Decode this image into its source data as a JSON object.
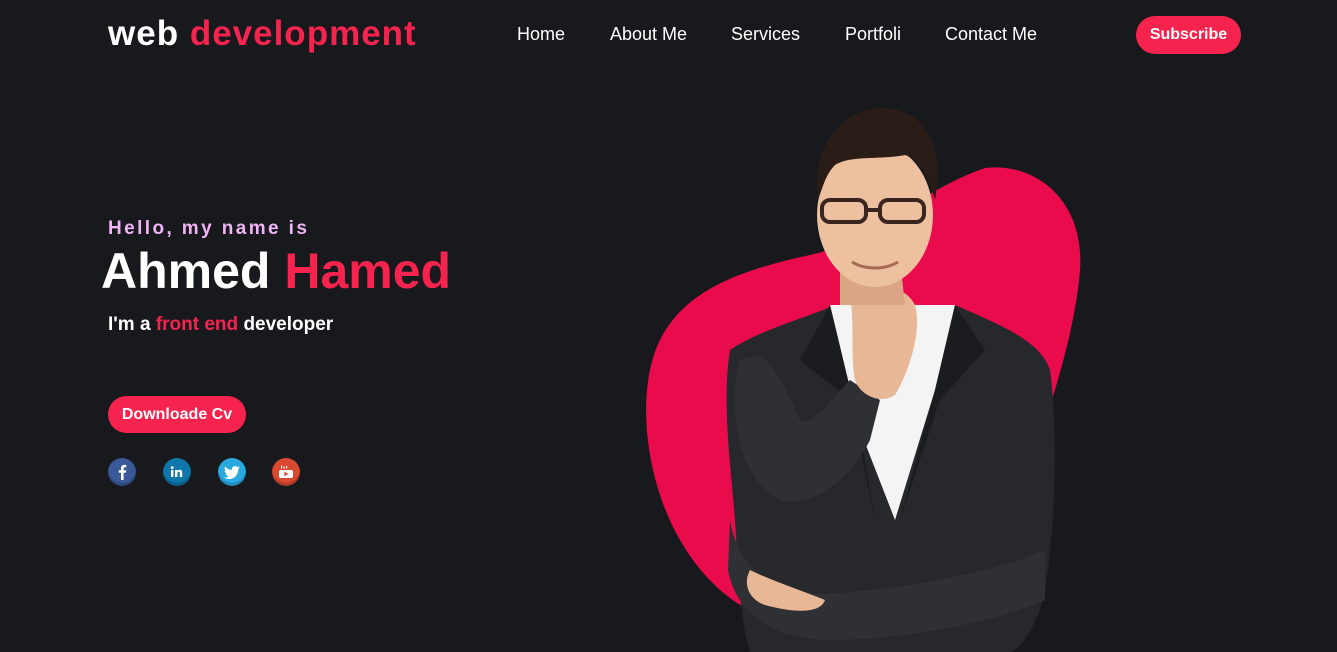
{
  "header": {
    "logo_prefix": "web",
    "logo_accent": "development",
    "nav": [
      {
        "label": "Home"
      },
      {
        "label": "About Me"
      },
      {
        "label": "Services"
      },
      {
        "label": "Portfoli"
      },
      {
        "label": "Contact Me"
      }
    ],
    "subscribe_label": "Subscribe"
  },
  "hero": {
    "greeting": "Hello, my name is",
    "first_name": "Ahmed",
    "last_name": "Hamed",
    "tagline_prefix": "I'm a",
    "tagline_highlight": "front end",
    "tagline_suffix": "developer",
    "cv_label": "Downloade Cv",
    "socials": [
      {
        "icon": "facebook-icon",
        "color": "#3b5998"
      },
      {
        "icon": "linkedin-icon",
        "color": "#0e76a8"
      },
      {
        "icon": "twitter-icon",
        "color": "#2aa9e0"
      },
      {
        "icon": "youtube-icon",
        "color": "#d8492f"
      }
    ]
  },
  "colors": {
    "background": "#17191c",
    "accent": "#f5234e",
    "greeting": "#f0b3f6",
    "blob": "#ea0b4c"
  }
}
